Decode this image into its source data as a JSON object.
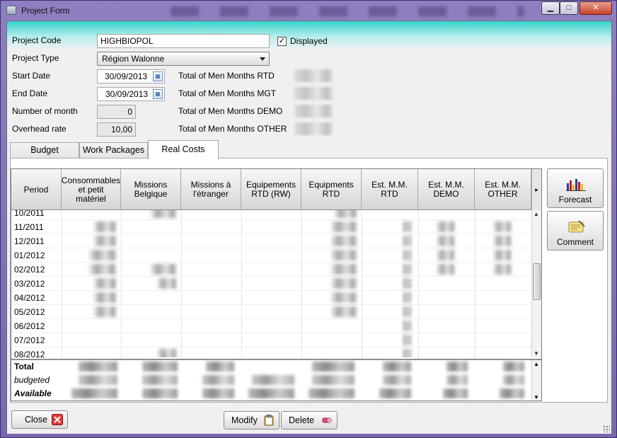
{
  "window": {
    "title": "Project Form",
    "controls": {
      "minimize": "▁",
      "maximize": "□",
      "close": "✕"
    }
  },
  "form": {
    "project_code_label": "Project Code",
    "project_code_value": "HIGHBIOPOL",
    "displayed_label": "Displayed",
    "displayed_checked": true,
    "project_type_label": "Project Type",
    "project_type_value": "Région Walonne",
    "start_date_label": "Start Date",
    "start_date_value": "30/09/2013",
    "end_date_label": "End Date",
    "end_date_value": "30/09/2013",
    "number_of_month_label": "Number of month",
    "number_of_month_value": "0",
    "overhead_rate_label": "Overhead rate",
    "overhead_rate_value": "10,00",
    "totals": [
      "Total of Men Months RTD",
      "Total of Men Months MGT",
      "Total of Men Months DEMO",
      "Total of Men Months OTHER"
    ]
  },
  "tabs": [
    "Budget",
    "Work Packages",
    "Real Costs"
  ],
  "active_tab": "Real Costs",
  "grid": {
    "columns": [
      "Period",
      "Consommables\net petit\nmatériel",
      "Missions\nBelgique",
      "Missions à\nl'étranger",
      "Equipements\nRTD (RW)",
      "Equipments\nRTD",
      "Est. M.M.\nRTD",
      "Est. M.M.\nDEMO",
      "Est. M.M.\nOTHER"
    ],
    "periods": [
      "10/2011",
      "11/2011",
      "12/2011",
      "01/2012",
      "02/2012",
      "03/2012",
      "04/2012",
      "05/2012",
      "06/2012",
      "07/2012",
      "08/2012"
    ],
    "total_rows": [
      "Total",
      "budgeted",
      "Available"
    ]
  },
  "side_buttons": {
    "forecast": "Forecast",
    "comment": "Comment"
  },
  "bottom_buttons": {
    "close": "Close",
    "modify": "Modify",
    "delete": "Delete"
  },
  "colors": {
    "accent_cyan": "#37d3cc",
    "window_frame": "#7a67ad"
  }
}
